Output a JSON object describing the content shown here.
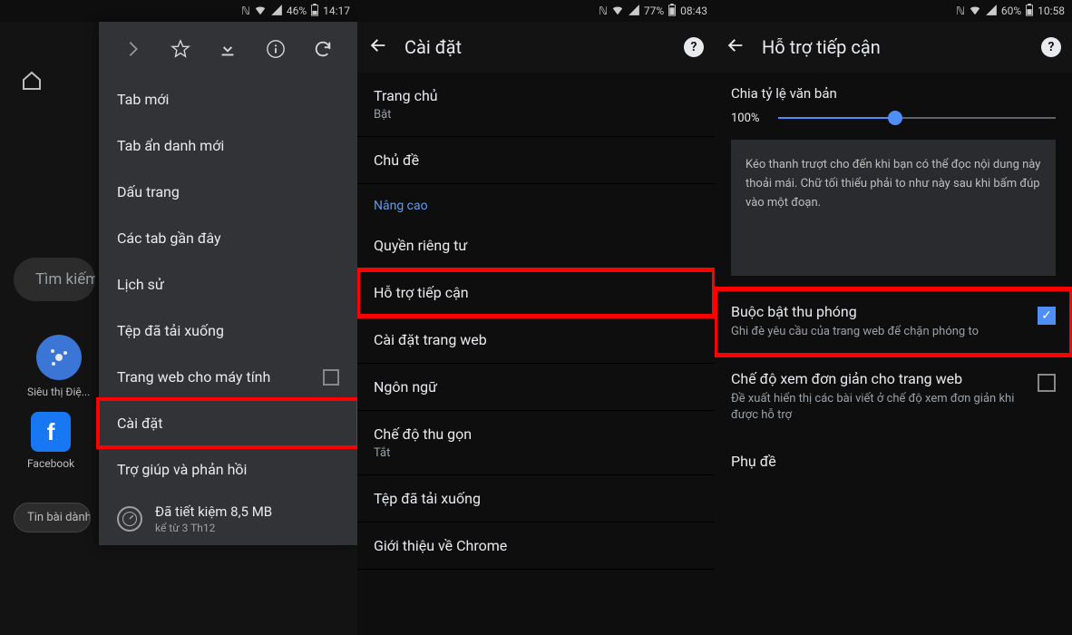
{
  "panel1": {
    "status": {
      "battery": "46%",
      "time": "14:17"
    },
    "search_placeholder": "Tìm kiếm",
    "shortcuts": [
      {
        "label": "Siêu thị Điệ..."
      },
      {
        "label": "Facebook"
      }
    ],
    "news_pill": "Tin bài dành",
    "menu": {
      "items": [
        "Tab mới",
        "Tab ẩn danh mới",
        "Dấu trang",
        "Các tab gần đây",
        "Lịch sử",
        "Tệp đã tải xuống",
        "Trang web cho máy tính",
        "Cài đặt",
        "Trợ giúp và phản hồi"
      ],
      "data_saved_line1": "Đã tiết kiệm 8,5 MB",
      "data_saved_line2": "kể từ 3 Th12"
    }
  },
  "panel2": {
    "status": {
      "battery": "77%",
      "time": "08:43"
    },
    "title": "Cài đặt",
    "rows": {
      "homepage": "Trang chủ",
      "homepage_sub": "Bật",
      "theme": "Chủ đề",
      "advanced_header": "Nâng cao",
      "privacy": "Quyền riêng tư",
      "accessibility": "Hỗ trợ tiếp cận",
      "site_settings": "Cài đặt trang web",
      "language": "Ngôn ngữ",
      "lite_mode": "Chế độ thu gọn",
      "lite_mode_sub": "Tắt",
      "downloads": "Tệp đã tải xuống",
      "about": "Giới thiệu về Chrome"
    }
  },
  "panel3": {
    "status": {
      "battery": "60%",
      "time": "10:58"
    },
    "title": "Hỗ trợ tiếp cận",
    "text_scaling_label": "Chia tỷ lệ văn bản",
    "text_scaling_value": "100%",
    "hint": "Kéo thanh trượt cho đến khi bạn có thể đọc nội dung này thoải mái. Chữ tối thiểu phải to như này sau khi bấm đúp vào một đoạn.",
    "force_zoom_title": "Buộc bật thu phóng",
    "force_zoom_sub": "Ghi đè yêu cầu của trang web để chặn phóng to",
    "simplified_title": "Chế độ xem đơn giản cho trang web",
    "simplified_sub": "Đề xuất hiển thị các bài viết ở chế độ xem đơn giản khi được hỗ trợ",
    "captions_title": "Phụ đề"
  }
}
